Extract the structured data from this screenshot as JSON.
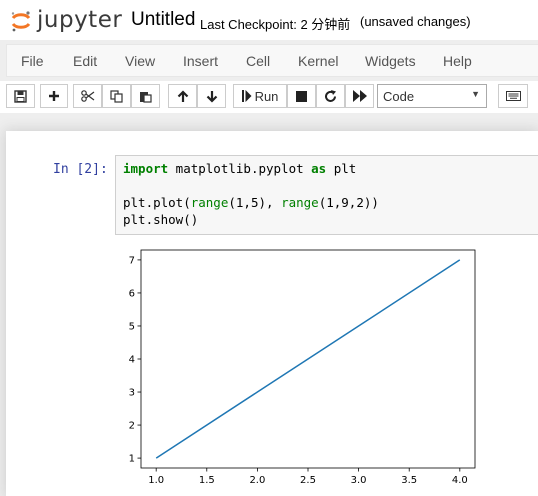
{
  "header": {
    "logo_text": "jupyter",
    "notebook_name": "Untitled",
    "checkpoint": "Last Checkpoint: 2 分钟前",
    "autosave": "(unsaved changes)"
  },
  "menubar": {
    "items": [
      "File",
      "Edit",
      "View",
      "Insert",
      "Cell",
      "Kernel",
      "Widgets",
      "Help"
    ]
  },
  "toolbar": {
    "run_label": "Run",
    "cell_type": "Code",
    "icons": [
      "save-icon",
      "plus-icon",
      "cut-icon",
      "copy-icon",
      "paste-icon",
      "arrow-up-icon",
      "arrow-down-icon",
      "step-run-icon",
      "stop-icon",
      "restart-icon",
      "fast-forward-icon",
      "keyboard-icon"
    ]
  },
  "cell": {
    "prompt": "In  [2]:",
    "code_lines": [
      [
        {
          "t": "import",
          "c": "kw"
        },
        {
          "t": " matplotlib.pyplot ",
          "c": ""
        },
        {
          "t": "as",
          "c": "kw"
        },
        {
          "t": " plt",
          "c": ""
        }
      ],
      [],
      [
        {
          "t": "plt.plot(",
          "c": ""
        },
        {
          "t": "range",
          "c": "bi"
        },
        {
          "t": "(1,5), ",
          "c": ""
        },
        {
          "t": "range",
          "c": "bi"
        },
        {
          "t": "(1,9,2))",
          "c": ""
        }
      ],
      [
        {
          "t": "plt.show()",
          "c": ""
        }
      ]
    ]
  },
  "chart_data": {
    "type": "line",
    "x": [
      1,
      2,
      3,
      4
    ],
    "series": [
      {
        "values": [
          1,
          3,
          5,
          7
        ]
      }
    ],
    "xlim": [
      0.85,
      4.15
    ],
    "ylim": [
      0.7,
      7.3
    ],
    "xticks": [
      "1.0",
      "1.5",
      "2.0",
      "2.5",
      "3.0",
      "3.5",
      "4.0"
    ],
    "xtick_values": [
      1.0,
      1.5,
      2.0,
      2.5,
      3.0,
      3.5,
      4.0
    ],
    "yticks": [
      "1",
      "2",
      "3",
      "4",
      "5",
      "6",
      "7"
    ],
    "ytick_values": [
      1,
      2,
      3,
      4,
      5,
      6,
      7
    ],
    "line_color": "#1f77b4",
    "title": "",
    "xlabel": "",
    "ylabel": ""
  }
}
